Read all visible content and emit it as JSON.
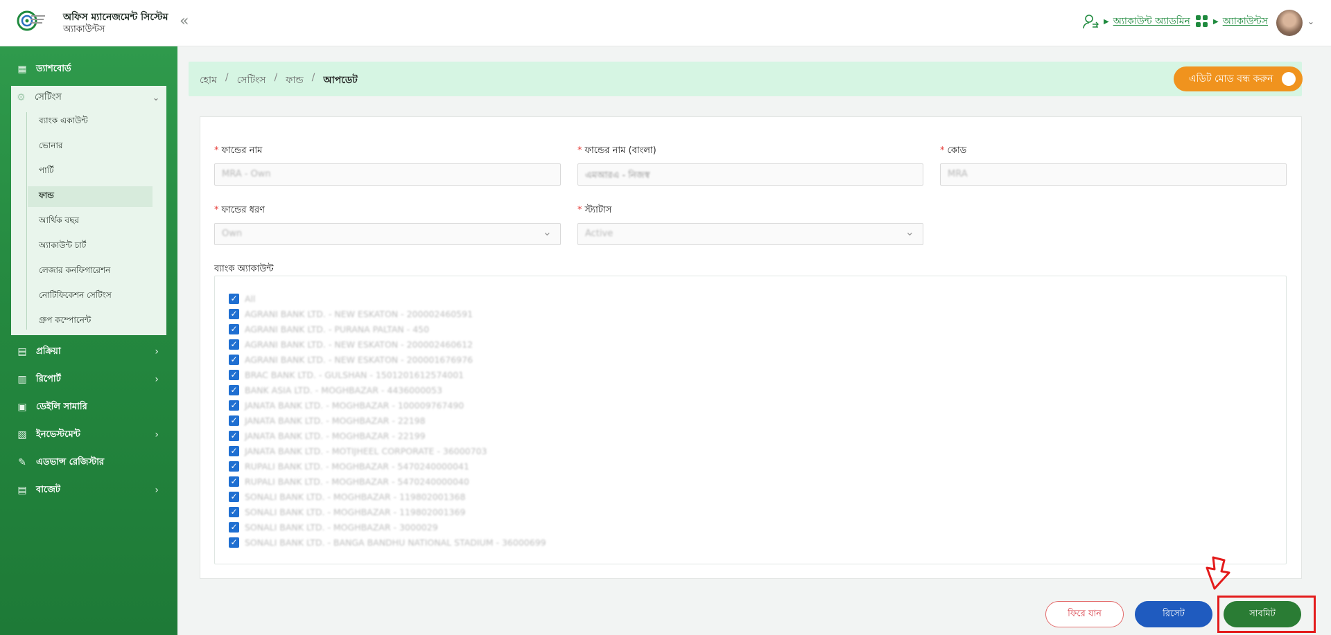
{
  "header": {
    "app_title": "অফিস ম্যানেজমেন্ট সিস্টেম",
    "app_subtitle": "অ্যাকাউন্টস",
    "collapse_glyph": "«",
    "admin_link": "অ্যাকাউন্ট অ্যাডমিন",
    "accounts_link": "অ্যাকাউন্টস"
  },
  "sidebar": {
    "dashboard": "ড্যাশবোর্ড",
    "settings": "সেটিংস",
    "settings_items": [
      "ব্যাংক একাউন্ট",
      "ভোনার",
      "পার্টি",
      "ফান্ড",
      "আর্থিক বছর",
      "অ্যাকাউন্ট চার্ট",
      "লেজার কনফিগারেশন",
      "নোটিফিকেশন সেটিংস",
      "গ্রুপ কম্পোনেন্ট"
    ],
    "active_item": "ফান্ড",
    "process": "প্রক্রিয়া",
    "report": "রিপোর্ট",
    "daily_summary": "ডেইলি সামারি",
    "investment": "ইনভেস্টমেন্ট",
    "advance_register": "এডভান্স রেজিস্টার",
    "budget": "বাজেট"
  },
  "breadcrumb": {
    "home": "হোম",
    "settings": "সেটিংস",
    "fund": "ফান্ড",
    "current": "আপডেট",
    "separator": "/"
  },
  "edit_mode": {
    "label": "এডিট মোড বন্ধ করুন"
  },
  "form": {
    "fund_name_label": "ফান্ডের নাম",
    "fund_name_value": "MRA - Own",
    "fund_name_bn_label": "ফান্ডের নাম (বাংলা)",
    "fund_name_bn_value": "এমআরএ - নিজস্ব",
    "code_label": "কোড",
    "code_value": "MRA",
    "fund_type_label": "ফান্ডের ধরণ",
    "fund_type_value": "Own",
    "status_label": "স্ট্যাটাস",
    "status_value": "Active",
    "required_mark": "*"
  },
  "bank_accounts": {
    "label": "ব্যাংক অ্যাকাউন্ট",
    "check_glyph": "✓",
    "items": [
      "All",
      "AGRANI BANK LTD. - NEW ESKATON - 200002460591",
      "AGRANI BANK LTD. - PURANA PALTAN - 450",
      "AGRANI BANK LTD. - NEW ESKATON - 200002460612",
      "AGRANI BANK LTD. - NEW ESKATON - 200001676976",
      "BRAC BANK LTD. - GULSHAN - 1501201612574001",
      "BANK ASIA LTD. - MOGHBAZAR - 4436000053",
      "JANATA BANK LTD. - MOGHBAZAR - 100009767490",
      "JANATA BANK LTD. - MOGHBAZAR - 22198",
      "JANATA BANK LTD. - MOGHBAZAR - 22199",
      "JANATA BANK LTD. - MOTIJHEEL CORPORATE - 36000703",
      "RUPALI BANK LTD. - MOGHBAZAR - 5470240000041",
      "RUPALI BANK LTD. - MOGHBAZAR - 5470240000040",
      "SONALI BANK LTD. - MOGHBAZAR - 119802001368",
      "SONALI BANK LTD. - MOGHBAZAR - 119802001369",
      "SONALI BANK LTD. - MOGHBAZAR - 3000029",
      "SONALI BANK LTD. - BANGA BANDHU NATIONAL STADIUM - 36000699"
    ]
  },
  "buttons": {
    "back": "ফিরে যান",
    "reset": "রিসেট",
    "submit": "সাবমিট"
  },
  "colors": {
    "primary_green": "#2f9a4c",
    "toggle_orange": "#f0931e",
    "reset_blue": "#1f5bbf",
    "submit_green": "#2a7c34",
    "annotation_red": "#e31b1b"
  }
}
